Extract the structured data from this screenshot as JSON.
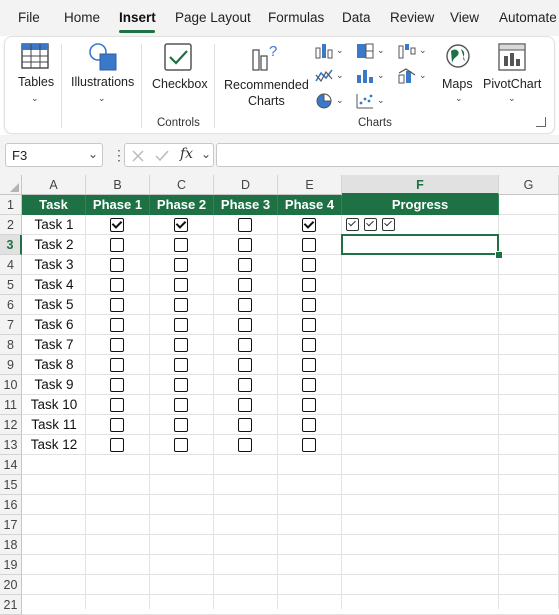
{
  "menu": {
    "items": [
      "File",
      "Home",
      "Insert",
      "Page Layout",
      "Formulas",
      "Data",
      "Review",
      "View",
      "Automate"
    ],
    "active": "Insert"
  },
  "ribbon": {
    "tables_label": "Tables",
    "illustrations_label": "Illustrations",
    "checkbox_label": "Checkbox",
    "controls_group": "Controls",
    "recommended_charts_label": "Recommended\nCharts",
    "maps_label": "Maps",
    "pivotchart_label": "PivotChart",
    "charts_group": "Charts"
  },
  "formula_bar": {
    "name_box": "F3",
    "fx": "fx",
    "value": ""
  },
  "grid": {
    "columns": [
      "A",
      "B",
      "C",
      "D",
      "E",
      "F",
      "G"
    ],
    "selected_column": "F",
    "rows": [
      "1",
      "2",
      "3",
      "4",
      "5",
      "6",
      "7",
      "8",
      "9",
      "10",
      "11",
      "12",
      "13",
      "14",
      "15",
      "16",
      "17",
      "18",
      "19",
      "20",
      "21"
    ],
    "selected_row": "3",
    "headers": [
      "Task",
      "Phase 1",
      "Phase 2",
      "Phase 3",
      "Phase 4",
      "Progress"
    ],
    "tasks": [
      {
        "name": "Task 1",
        "phases": [
          true,
          true,
          false,
          true
        ]
      },
      {
        "name": "Task 2",
        "phases": [
          false,
          false,
          false,
          false
        ]
      },
      {
        "name": "Task 3",
        "phases": [
          false,
          false,
          false,
          false
        ]
      },
      {
        "name": "Task 4",
        "phases": [
          false,
          false,
          false,
          false
        ]
      },
      {
        "name": "Task 5",
        "phases": [
          false,
          false,
          false,
          false
        ]
      },
      {
        "name": "Task 6",
        "phases": [
          false,
          false,
          false,
          false
        ]
      },
      {
        "name": "Task 7",
        "phases": [
          false,
          false,
          false,
          false
        ]
      },
      {
        "name": "Task 8",
        "phases": [
          false,
          false,
          false,
          false
        ]
      },
      {
        "name": "Task 9",
        "phases": [
          false,
          false,
          false,
          false
        ]
      },
      {
        "name": "Task 10",
        "phases": [
          false,
          false,
          false,
          false
        ]
      },
      {
        "name": "Task 11",
        "phases": [
          false,
          false,
          false,
          false
        ]
      },
      {
        "name": "Task 12",
        "phases": [
          false,
          false,
          false,
          false
        ]
      }
    ],
    "progress_row1_checks": 3
  },
  "colors": {
    "header_green": "#1e7145",
    "selection_green": "#1e7145"
  }
}
